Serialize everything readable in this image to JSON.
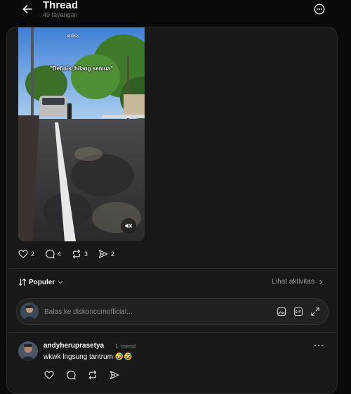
{
  "header": {
    "title": "Thread",
    "views": "49 tayangan",
    "back_icon": "arrow-left-icon",
    "more_icon": "more-circle-icon"
  },
  "post": {
    "video": {
      "caption_overlay": "\"Definisi hilang semua\"",
      "watermark": "xplisk",
      "mute_icon": "speaker-muted-icon"
    },
    "actions": [
      {
        "name": "like",
        "icon": "heart-icon",
        "count": "2"
      },
      {
        "name": "comment",
        "icon": "comment-icon",
        "count": "4"
      },
      {
        "name": "repost",
        "icon": "repost-icon",
        "count": "3"
      },
      {
        "name": "share",
        "icon": "send-icon",
        "count": "2"
      }
    ]
  },
  "sort": {
    "label": "Populer",
    "activity_link": "Lihat aktivitas"
  },
  "reply": {
    "placeholder": "Balas ke diskoncomofficial...",
    "icons": [
      "image-icon",
      "gif-icon",
      "expand-icon"
    ]
  },
  "comments": [
    {
      "username": "andyheruprasetya",
      "time": "1 menit",
      "text": "wkwk lngsung tantrum 🤣🤣"
    }
  ],
  "colors": {
    "background": "#0a0a0a",
    "card": "#181818",
    "text": "#f3f5f7",
    "muted": "#777777",
    "border": "#2a2a2a"
  }
}
